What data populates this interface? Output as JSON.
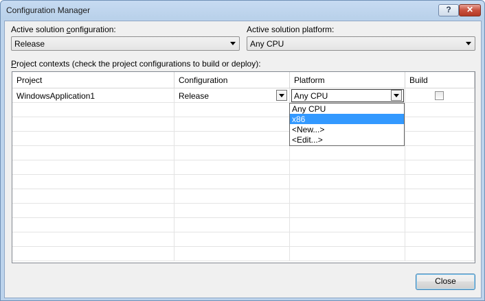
{
  "window": {
    "title": "Configuration Manager",
    "help_label": "?",
    "close_label": "✕"
  },
  "solution_config": {
    "label_pre": "Active solution ",
    "label_ul": "c",
    "label_post": "onfiguration:",
    "value": "Release"
  },
  "solution_platform": {
    "label": "Active solution platform:",
    "value": "Any CPU"
  },
  "project_contexts": {
    "label_ul": "P",
    "label_post": "roject contexts (check the project configurations to build or deploy):"
  },
  "grid": {
    "columns": [
      "Project",
      "Configuration",
      "Platform",
      "Build"
    ],
    "rows": [
      {
        "project": "WindowsApplication1",
        "configuration": "Release",
        "platform": "Any CPU",
        "build": false
      }
    ]
  },
  "platform_dropdown": {
    "options": [
      "Any CPU",
      "x86",
      "<New...>",
      "<Edit...>"
    ],
    "highlighted": "x86"
  },
  "footer": {
    "close_label": "Close"
  },
  "icons": {
    "dropdown_arrow": "chevron-down-icon"
  }
}
